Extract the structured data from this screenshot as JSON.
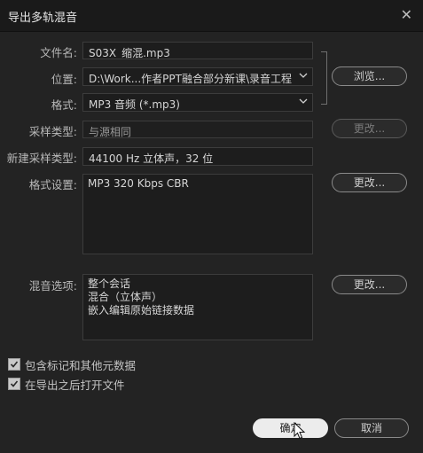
{
  "dialog": {
    "title": "导出多轨混音",
    "close": "✕"
  },
  "form": {
    "filename_label": "文件名:",
    "filename_value": "S03X_缩混.mp3",
    "location_label": "位置:",
    "location_value": "D:\\Work...作者PPT融合部分新课\\录音工程",
    "format_label": "格式:",
    "format_value": "MP3 音频 (*.mp3)",
    "sample_type_label": "采样类型:",
    "sample_type_value": "与源相同",
    "new_sample_type_label": "新建采样类型:",
    "new_sample_type_value": "44100 Hz 立体声，32 位",
    "format_settings_label": "格式设置:",
    "format_settings_value": "MP3 320 Kbps CBR",
    "mix_options_label": "混音选项:",
    "mix_options_lines": [
      "整个会话",
      "混合（立体声）",
      "嵌入编辑原始链接数据"
    ]
  },
  "buttons": {
    "browse": "浏览...",
    "change_sample": "更改...",
    "change_format": "更改...",
    "change_mix": "更改...",
    "ok": "确定",
    "cancel": "取消"
  },
  "checkboxes": [
    {
      "label": "包含标记和其他元数据",
      "checked": true
    },
    {
      "label": "在导出之后打开文件",
      "checked": true
    }
  ]
}
